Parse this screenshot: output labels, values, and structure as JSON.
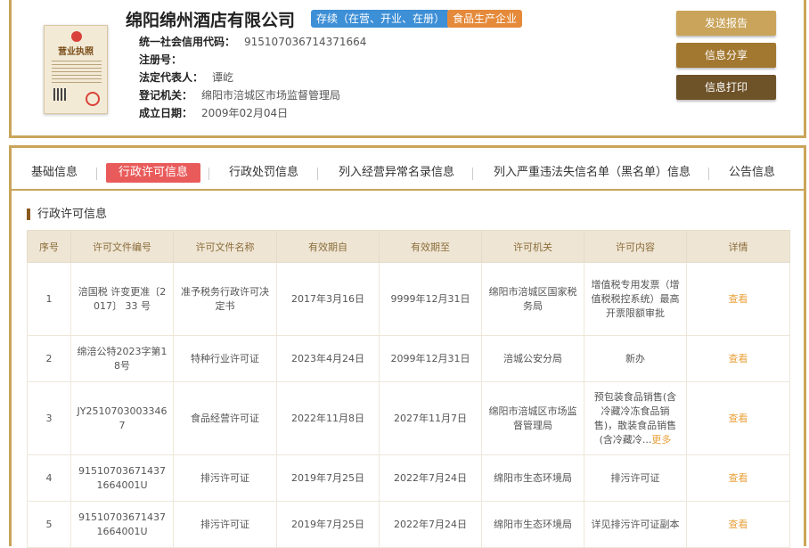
{
  "company": {
    "name": "绵阳绵州酒店有限公司",
    "status_badge": "存续（在营、开业、在册）",
    "type_badge": "食品生产企业",
    "license_text": "营业执照",
    "fields": [
      {
        "label": "统一社会信用代码：",
        "value": "915107036714371664"
      },
      {
        "label": "注册号：",
        "value": ""
      },
      {
        "label": "法定代表人：",
        "value": "谭屹"
      },
      {
        "label": "登记机关：",
        "value": "绵阳市涪城区市场监督管理局"
      },
      {
        "label": "成立日期：",
        "value": "2009年02月04日"
      }
    ]
  },
  "actions": {
    "send_report": "发送报告",
    "share": "信息分享",
    "print": "信息打印"
  },
  "tabs": [
    "基础信息",
    "行政许可信息",
    "行政处罚信息",
    "列入经营异常名录信息",
    "列入严重违法失信名单（黑名单）信息",
    "公告信息"
  ],
  "active_tab": "行政许可信息",
  "section_title": "行政许可信息",
  "table": {
    "headers": [
      "序号",
      "许可文件编号",
      "许可文件名称",
      "有效期自",
      "有效期至",
      "许可机关",
      "许可内容",
      "详情"
    ],
    "rows": [
      {
        "no": "1",
        "doc_no": "涪国税 许变更准〔2017〕 33 号",
        "doc_name": "准予税务行政许可决定书",
        "from": "2017年3月16日",
        "to": "9999年12月31日",
        "authority": "绵阳市涪城区国家税务局",
        "content": "增值税专用发票（增值税税控系统）最高开票限额审批",
        "more": "",
        "detail": "查看"
      },
      {
        "no": "2",
        "doc_no": "绵涪公特2023字第18号",
        "doc_name": "特种行业许可证",
        "from": "2023年4月24日",
        "to": "2099年12月31日",
        "authority": "涪城公安分局",
        "content": "新办",
        "more": "",
        "detail": "查看"
      },
      {
        "no": "3",
        "doc_no": "JY25107030033467",
        "doc_name": "食品经营许可证",
        "from": "2022年11月8日",
        "to": "2027年11月7日",
        "authority": "绵阳市涪城区市场监督管理局",
        "content": "预包装食品销售(含冷藏冷冻食品销售)，散装食品销售(含冷藏冷...",
        "more": "更多",
        "detail": "查看"
      },
      {
        "no": "4",
        "doc_no": "915107036714371664001U",
        "doc_name": "排污许可证",
        "from": "2019年7月25日",
        "to": "2022年7月24日",
        "authority": "绵阳市生态环境局",
        "content": "排污许可证",
        "more": "",
        "detail": "查看"
      },
      {
        "no": "5",
        "doc_no": "915107036714371664001U",
        "doc_name": "排污许可证",
        "from": "2019年7月25日",
        "to": "2022年7月24日",
        "authority": "绵阳市生态环境局",
        "content": "详见排污许可证副本",
        "more": "",
        "detail": "查看"
      }
    ]
  }
}
